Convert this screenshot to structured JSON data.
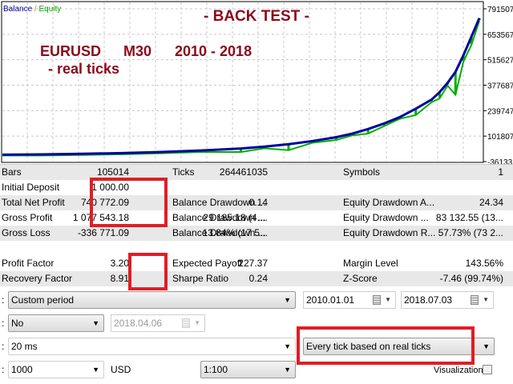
{
  "chart": {
    "legend_balance": "Balance",
    "legend_sep": "/",
    "legend_equity": "Equity",
    "title": "- BACK TEST -",
    "subtitle_line1": [
      "EURUSD",
      "M30",
      "2010 - 2018"
    ],
    "subtitle_line2": "-  real ticks",
    "colors": {
      "balance": "#0000a0",
      "equity": "#00b000",
      "annotation": "#8b0a1a"
    }
  },
  "chart_data": {
    "type": "line",
    "title": "Balance / Equity",
    "y_ticks": [
      791507,
      653567,
      515627,
      377687,
      239747,
      101807,
      -36133
    ],
    "ylim": [
      -36133,
      791507
    ],
    "x": [
      0,
      5,
      10,
      15,
      20,
      25,
      30,
      33,
      36,
      39,
      42,
      44,
      46,
      48,
      50,
      52,
      54,
      55,
      56,
      57,
      58,
      59,
      60
    ],
    "series": [
      {
        "name": "Balance",
        "values": [
          1000,
          3000,
          6000,
          10000,
          16000,
          24000,
          35000,
          45000,
          58000,
          75000,
          96000,
          115000,
          140000,
          170000,
          205000,
          250000,
          300000,
          340000,
          390000,
          450000,
          540000,
          640000,
          740772
        ]
      },
      {
        "name": "Equity",
        "values": [
          1000,
          1000,
          4000,
          8000,
          13000,
          20000,
          20000,
          40000,
          30000,
          70000,
          85000,
          110000,
          120000,
          160000,
          200000,
          220000,
          290000,
          310000,
          380000,
          330000,
          510000,
          600000,
          730000
        ]
      }
    ]
  },
  "stats": {
    "rows": [
      {
        "l1": "Bars",
        "v1": "105014",
        "l2": "Ticks",
        "v2": "264461035",
        "l3": "Symbols",
        "v3": "1"
      },
      {
        "l1": "Initial Deposit",
        "v1": "1 000.00",
        "l2": "",
        "v2": "",
        "l3": "",
        "v3": ""
      },
      {
        "l1": "Total Net Profit",
        "v1": "740 772.09",
        "l2": "Balance Drawdown ...",
        "v2": "0.14",
        "l3": "Equity Drawdown A...",
        "v3": "24.34"
      },
      {
        "l1": "Gross Profit",
        "v1": "1 077 543.18",
        "l2": "Balance Drawdown ...",
        "v2": "29 185.18 (4....",
        "l3": "Equity Drawdown ...",
        "v3": "83 132.55 (13..."
      },
      {
        "l1": "Gross Loss",
        "v1": "-336 771.09",
        "l2": "Balance Drawdown ...",
        "v2": "13.84% (17 5...",
        "l3": "Equity Drawdown R...",
        "v3": "57.73% (73 2..."
      },
      {
        "l1": "Profit Factor",
        "v1": "3.20",
        "l2": "Expected Payoff",
        "v2": "227.37",
        "l3": "Margin Level",
        "v3": "143.56%"
      },
      {
        "l1": "Recovery Factor",
        "v1": "8.91",
        "l2": "Sharpe Ratio",
        "v2": "0.24",
        "l3": "Z-Score",
        "v3": "-7.46 (99.74%)"
      }
    ]
  },
  "settings": {
    "colon": ":",
    "period": "Custom period",
    "date_from": "2010.01.01",
    "date_to": "2018.07.03",
    "forward": "No",
    "forward_date": "2018.04.06",
    "delays": "20 ms",
    "model": "Every tick based on real ticks",
    "deposit": "1000",
    "currency": "USD",
    "leverage": "1:100",
    "visualization": "Visualization"
  }
}
